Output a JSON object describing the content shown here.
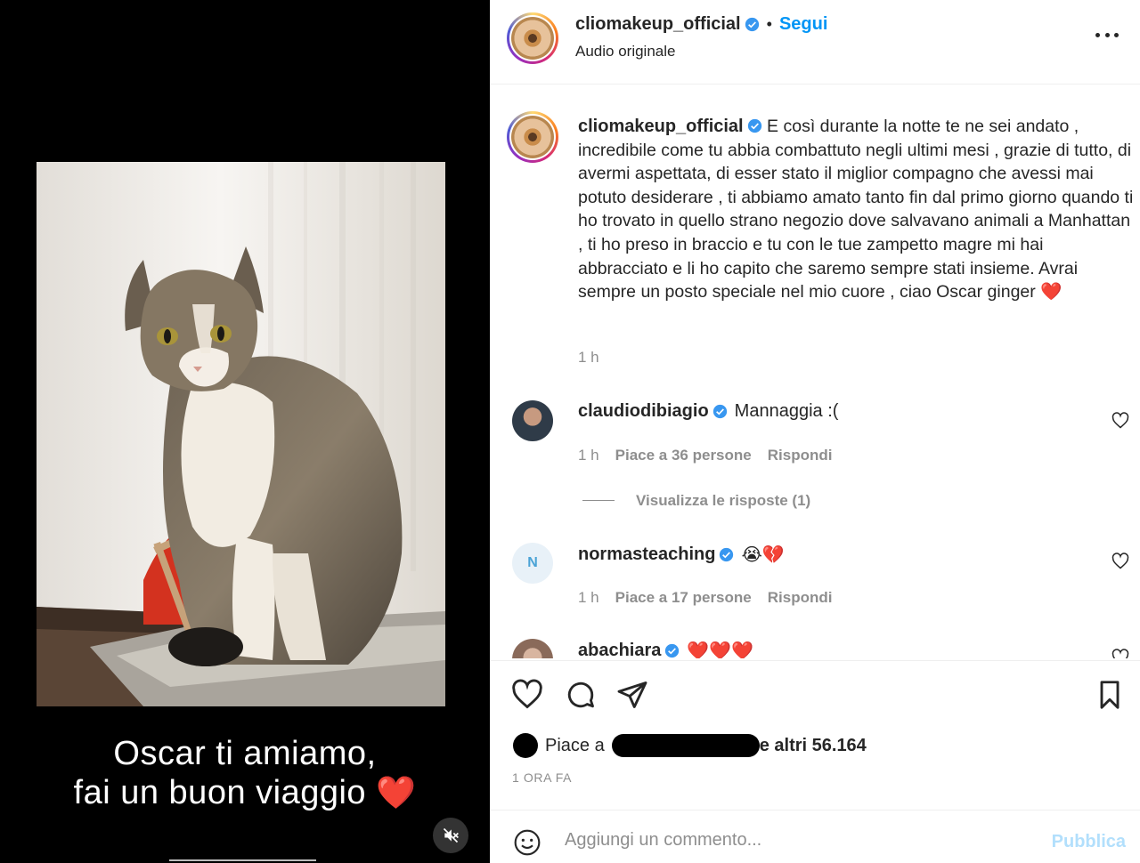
{
  "media": {
    "caption_line1": "Oscar ti amiamo,",
    "caption_line2": "fai un buon viaggio",
    "caption_emoji": "❤️",
    "mute_icon": "muted-speaker-icon"
  },
  "header": {
    "username": "cliomakeup_official",
    "separator": "•",
    "follow_label": "Segui",
    "audio_label": "Audio originale",
    "more_icon": "more-options-icon"
  },
  "caption": {
    "username": "cliomakeup_official",
    "text": "E così durante la notte te ne sei andato , incredibile come tu abbia combattuto negli ultimi mesi , grazie di tutto, di avermi aspettata, di esser stato il miglior compagno che avessi mai potuto desiderare , ti abbiamo amato tanto fin dal primo giorno quando ti ho trovato in quello strano negozio dove salvavano animali a Manhattan , ti ho preso in braccio e tu con le tue zampetto magre mi hai abbracciato e li ho capito che saremo sempre stati insieme. Avrai sempre un posto speciale nel mio cuore , ciao Oscar ginger",
    "emoji": "❤️",
    "time": "1 h"
  },
  "comments": [
    {
      "username": "claudiodibiagio",
      "text": "Mannaggia :(",
      "time": "1 h",
      "likes": "Piace a 36 persone",
      "reply": "Rispondi",
      "view_replies": "Visualizza le risposte (1)"
    },
    {
      "username": "normasteaching",
      "text": "😭💔",
      "time": "1 h",
      "likes": "Piace a 17 persone",
      "reply": "Rispondi"
    },
    {
      "username": "abachiara",
      "text": "❤️❤️❤️"
    }
  ],
  "actions": {
    "like_icon": "heart-icon",
    "comment_icon": "comment-bubble-icon",
    "share_icon": "paper-plane-icon",
    "save_icon": "bookmark-icon"
  },
  "likes": {
    "prefix": "Piace a",
    "suffix": "e altri 56.164"
  },
  "post_time": "1 ORA FA",
  "comment_box": {
    "placeholder": "Aggiungi un commento...",
    "publish_label": "Pubblica",
    "emoji_icon": "emoji-smiley-icon"
  },
  "colors": {
    "accent": "#0095f6",
    "muted_text": "#8e8e8e",
    "verified_badge": "#3897f0",
    "publish_disabled": "#b2dffc"
  }
}
